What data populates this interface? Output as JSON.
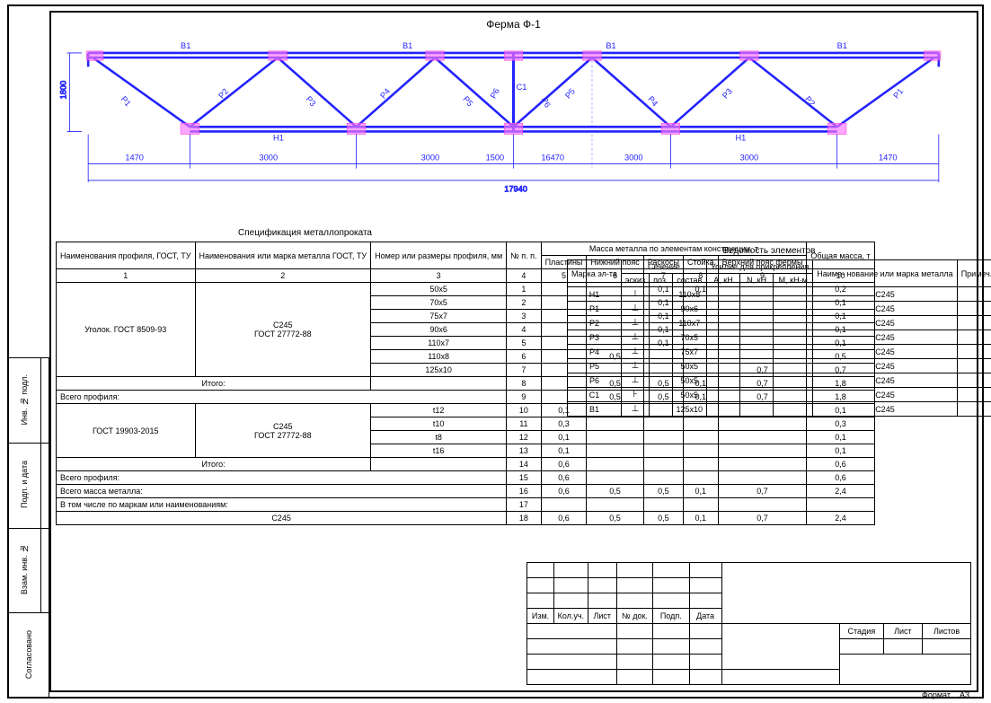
{
  "drawing": {
    "title": "Ферма Ф-1",
    "height_dim": "1800",
    "total_dim": "17940",
    "spans": [
      "1470",
      "3000",
      "3000",
      "1500",
      "16470",
      "3000",
      "3000",
      "1470"
    ],
    "top_labels": [
      "В1",
      "В1",
      "В1",
      "В1"
    ],
    "bottom_labels": [
      "Н1",
      "Н1"
    ],
    "diag_labels": [
      "Р1",
      "Р2",
      "Р3",
      "Р4",
      "Р5",
      "Р6",
      "С1",
      "Р6",
      "Р5",
      "Р4",
      "Р3",
      "Р2",
      "Р1"
    ]
  },
  "spec": {
    "title": "Спецификация металлопроката",
    "headers": {
      "col1": "Наименования профиля, ГОСТ, ТУ",
      "col2": "Наименования или марка металла ГОСТ, ТУ",
      "col3": "Номер или размеры профиля, мм",
      "col4": "№ п. п.",
      "mass_group": "Масса металла по элементам конструкции, т",
      "m5": "Пластины",
      "m6": "Нижний пояс",
      "m7": "Раскосы",
      "m8": "Стойка",
      "m9": "Верхний пояс фермы",
      "col10": "Общая масса, т"
    },
    "numrow": [
      "1",
      "2",
      "3",
      "4",
      "5",
      "6",
      "7",
      "8",
      "9",
      "10"
    ],
    "group1": {
      "col1": "Уголок. ГОСТ 8509-93",
      "col2": "С245\nГОСТ 27772-88"
    },
    "rows1": [
      {
        "prof": "50x5",
        "n": "1",
        "v": [
          "",
          "",
          "0,1",
          "0,1",
          "",
          ""
        ],
        "tot": "0,2"
      },
      {
        "prof": "70x5",
        "n": "2",
        "v": [
          "",
          "",
          "0,1",
          "",
          "",
          ""
        ],
        "tot": "0,1"
      },
      {
        "prof": "75x7",
        "n": "3",
        "v": [
          "",
          "",
          "0,1",
          "",
          "",
          ""
        ],
        "tot": "0,1"
      },
      {
        "prof": "90x6",
        "n": "4",
        "v": [
          "",
          "",
          "0,1",
          "",
          "",
          ""
        ],
        "tot": "0,1"
      },
      {
        "prof": "110x7",
        "n": "5",
        "v": [
          "",
          "",
          "0,1",
          "",
          "",
          ""
        ],
        "tot": "0,1"
      },
      {
        "prof": "110x8",
        "n": "6",
        "v": [
          "",
          "0,5",
          "",
          "",
          "",
          ""
        ],
        "tot": "0,5"
      },
      {
        "prof": "125x10",
        "n": "7",
        "v": [
          "",
          "",
          "",
          "",
          "0,7"
        ],
        "tot": "0,7"
      }
    ],
    "itogo1": {
      "lbl": "Итого:",
      "n": "8",
      "v": [
        "",
        "0,5",
        "0,5",
        "0,1",
        "0,7"
      ],
      "tot": "1,8"
    },
    "vs_prof1": {
      "lbl": "Всего профиля:",
      "n": "9",
      "v": [
        "",
        "0,5",
        "0,5",
        "0,1",
        "0,7"
      ],
      "tot": "1,8"
    },
    "group2": {
      "col1": "ГОСТ 19903-2015",
      "col2": "С245\nГОСТ 27772-88"
    },
    "rows2": [
      {
        "prof": "t12",
        "n": "10",
        "v": [
          "0,1",
          "",
          "",
          "",
          "",
          ""
        ],
        "tot": "0,1"
      },
      {
        "prof": "t10",
        "n": "11",
        "v": [
          "0,3",
          "",
          "",
          "",
          "",
          ""
        ],
        "tot": "0,3"
      },
      {
        "prof": "t8",
        "n": "12",
        "v": [
          "0,1",
          "",
          "",
          "",
          "",
          ""
        ],
        "tot": "0,1"
      },
      {
        "prof": "t16",
        "n": "13",
        "v": [
          "0,1",
          "",
          "",
          "",
          "",
          ""
        ],
        "tot": "0,1"
      }
    ],
    "itogo2": {
      "lbl": "Итого:",
      "n": "14",
      "v": [
        "0,6",
        "",
        "",
        "",
        "",
        ""
      ],
      "tot": "0,6"
    },
    "vs_prof2": {
      "lbl": "Всего профиля:",
      "n": "15",
      "v": [
        "0,6",
        "",
        "",
        "",
        "",
        ""
      ],
      "tot": "0,6"
    },
    "total_mass": {
      "lbl": "Всего масса металла:",
      "n": "16",
      "v": [
        "0,6",
        "0,5",
        "0,5",
        "0,1",
        "0,7"
      ],
      "tot": "2,4"
    },
    "by_mark": {
      "lbl": "В том числе по маркам или наименованиям:",
      "n": "17",
      "v": [
        "",
        "",
        "",
        "",
        "",
        ""
      ],
      "tot": ""
    },
    "mark_row": {
      "lbl": "С245",
      "n": "18",
      "v": [
        "0,6",
        "0,5",
        "0,5",
        "0,1",
        "0,7"
      ],
      "tot": "2,4"
    }
  },
  "elem": {
    "title": "Ведомость элементов",
    "headers": {
      "mark": "Марка эл-та",
      "sect": "Сечение",
      "force": "Усилие для прикрепления",
      "name": "Наиме-\nнование или марка металла",
      "note": "Примеч.",
      "sk": "эскиз",
      "pos": "поз.",
      "comp": "состав",
      "A": "A, кН",
      "N": "N, кН",
      "M": "М, кН·м"
    },
    "rows": [
      {
        "m": "Н1",
        "sk": "⊥",
        "c": "110x8",
        "mat": "С245"
      },
      {
        "m": "Р1",
        "sk": "⊥",
        "c": "90x6",
        "mat": "С245"
      },
      {
        "m": "Р2",
        "sk": "⊥",
        "c": "110x7",
        "mat": "С245"
      },
      {
        "m": "Р3",
        "sk": "⊥",
        "c": "70x5",
        "mat": "С245"
      },
      {
        "m": "Р4",
        "sk": "⊥",
        "c": "75x7",
        "mat": "С245"
      },
      {
        "m": "Р5",
        "sk": "⊥",
        "c": "50x5",
        "mat": "С245"
      },
      {
        "m": "Р6",
        "sk": "⊥",
        "c": "50x5",
        "mat": "С245"
      },
      {
        "m": "С1",
        "sk": "⊦",
        "c": "50x5",
        "mat": "С245"
      },
      {
        "m": "В1",
        "sk": "⊥",
        "c": "125x10",
        "mat": "С245"
      }
    ]
  },
  "bind_labels": [
    "Инв. № подл.",
    "Подп. и дата",
    "Взам. инв. №",
    "Согласовано"
  ],
  "tb": {
    "rev_hdr": [
      "Изм.",
      "Кол.уч.",
      "Лист",
      "№ док.",
      "Подп.",
      "Дата"
    ],
    "stage": "Стадия",
    "sheet": "Лист",
    "sheets": "Листов",
    "format": "Формат",
    "fmt_val": "А3"
  }
}
